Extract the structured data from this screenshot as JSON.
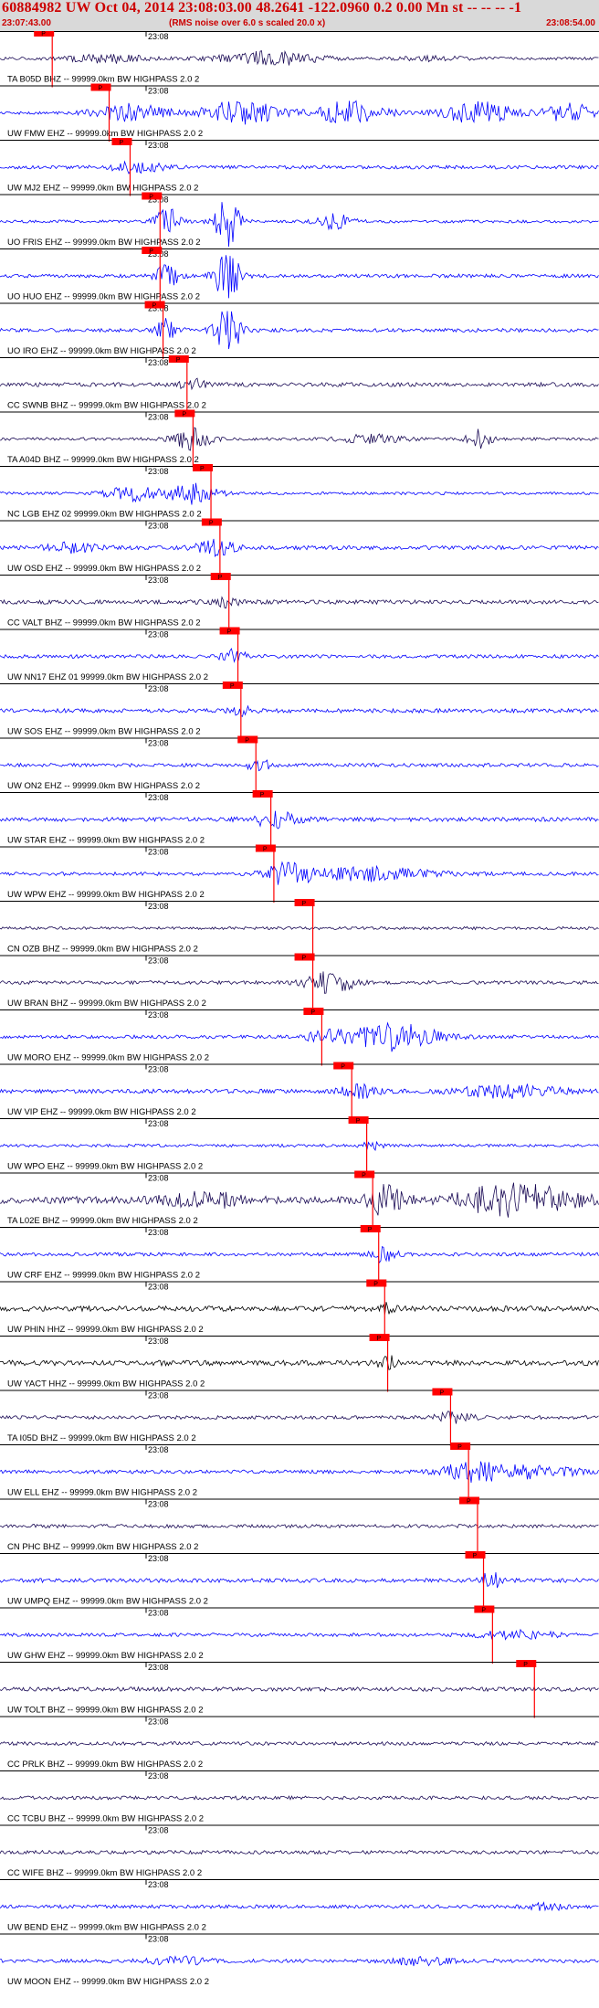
{
  "header": {
    "title": "60884982 UW Oct 04, 2014 23:08:03.00   48.2641 -122.0960  0.2 0.00 Mn st -- -- -- -1",
    "start_time": "23:07:43.00",
    "rms_note": "(RMS noise over 6.0 s scaled 20.0 x)",
    "end_time": "23:08:54.00"
  },
  "colors": {
    "accent": "#cc0000",
    "pick_box": "#ff0000",
    "trace_blue": "#0000ff",
    "trace_navy": "#1a0a55",
    "trace_black": "#000000"
  },
  "tick_label": "23:08",
  "pick_label": "P",
  "traces": [
    {
      "label": "TA B05D BHZ -- 99999.0km BW  HIGHPASS  2.0  2",
      "color": "navy",
      "pick": 0.075,
      "amp": 0.5,
      "seed": 1,
      "bursts": [
        [
          0.18,
          0.06,
          1.4
        ],
        [
          0.45,
          0.08,
          2.2
        ],
        [
          0.72,
          0.05,
          0.7
        ]
      ]
    },
    {
      "label": "UW FMW EHZ -- 99999.0km BW  HIGHPASS  2.0  2",
      "color": "blue",
      "pick": 0.17,
      "amp": 0.5,
      "seed": 2,
      "bursts": [
        [
          0.22,
          0.06,
          3.0
        ],
        [
          0.4,
          0.06,
          4.5
        ],
        [
          0.58,
          0.06,
          3.8
        ],
        [
          0.8,
          0.06,
          3.6
        ],
        [
          0.95,
          0.04,
          3.2
        ]
      ]
    },
    {
      "label": "UW MJ2 EHZ -- 99999.0km BW  HIGHPASS  2.0  2",
      "color": "blue",
      "pick": 0.205,
      "amp": 0.6,
      "seed": 3,
      "bursts": [
        [
          0.23,
          0.04,
          2.0
        ]
      ]
    },
    {
      "label": "UO FRIS EHZ -- 99999.0km BW  HIGHPASS  2.0  2",
      "color": "blue",
      "pick": 0.255,
      "amp": 0.5,
      "seed": 4,
      "bursts": [
        [
          0.28,
          0.02,
          5.0
        ],
        [
          0.38,
          0.02,
          9.0
        ],
        [
          0.56,
          0.03,
          2.5
        ]
      ]
    },
    {
      "label": "UO HUO EHZ -- 99999.0km BW  HIGHPASS  2.0  2",
      "color": "blue",
      "pick": 0.255,
      "amp": 0.6,
      "seed": 5,
      "bursts": [
        [
          0.28,
          0.02,
          4.0
        ],
        [
          0.38,
          0.02,
          9.0
        ]
      ]
    },
    {
      "label": "UO IRO EHZ -- 99999.0km BW  HIGHPASS  2.0  2",
      "color": "blue",
      "pick": 0.26,
      "amp": 0.6,
      "seed": 6,
      "bursts": [
        [
          0.28,
          0.02,
          4.0
        ],
        [
          0.38,
          0.02,
          9.0
        ]
      ]
    },
    {
      "label": "CC SWNB BHZ -- 99999.0km BW  HIGHPASS  2.0  2",
      "color": "navy",
      "pick": 0.3,
      "amp": 0.7,
      "seed": 7,
      "bursts": [
        [
          0.32,
          0.02,
          2.0
        ]
      ]
    },
    {
      "label": "TA A04D BHZ -- 99999.0km BW  HIGHPASS  2.0  2",
      "color": "navy",
      "pick": 0.31,
      "amp": 0.5,
      "seed": 8,
      "bursts": [
        [
          0.32,
          0.03,
          4.0
        ],
        [
          0.62,
          0.05,
          1.5
        ],
        [
          0.8,
          0.02,
          3.0
        ]
      ]
    },
    {
      "label": "NC LGB EHZ 02 99999.0km BW  HIGHPASS  2.0  2",
      "color": "blue",
      "pick": 0.34,
      "amp": 0.5,
      "seed": 9,
      "bursts": [
        [
          0.22,
          0.04,
          2.5
        ],
        [
          0.32,
          0.04,
          3.5
        ]
      ]
    },
    {
      "label": "UW OSD EHZ -- 99999.0km BW  HIGHPASS  2.0  2",
      "color": "blue",
      "pick": 0.355,
      "amp": 0.7,
      "seed": 10,
      "bursts": [
        [
          0.36,
          0.03,
          2.5
        ],
        [
          0.12,
          0.04,
          1.5
        ]
      ]
    },
    {
      "label": "CC VALT BHZ -- 99999.0km BW  HIGHPASS  2.0  2",
      "color": "navy",
      "pick": 0.37,
      "amp": 0.7,
      "seed": 11,
      "bursts": [
        [
          0.38,
          0.03,
          1.8
        ]
      ]
    },
    {
      "label": "UW NN17 EHZ 01 99999.0km BW  HIGHPASS  2.0  2",
      "color": "blue",
      "pick": 0.385,
      "amp": 0.6,
      "seed": 12,
      "bursts": [
        [
          0.39,
          0.02,
          2.5
        ]
      ]
    },
    {
      "label": "UW SOS EHZ -- 99999.0km BW  HIGHPASS  2.0  2",
      "color": "blue",
      "pick": 0.39,
      "amp": 0.7,
      "seed": 13,
      "bursts": [
        [
          0.4,
          0.02,
          1.5
        ]
      ]
    },
    {
      "label": "UW ON2 EHZ -- 99999.0km BW  HIGHPASS  2.0  2",
      "color": "blue",
      "pick": 0.415,
      "amp": 0.6,
      "seed": 14,
      "bursts": [
        [
          0.43,
          0.02,
          2.5
        ]
      ]
    },
    {
      "label": "UW STAR EHZ -- 99999.0km BW  HIGHPASS  2.0  2",
      "color": "blue",
      "pick": 0.44,
      "amp": 0.7,
      "seed": 15,
      "bursts": [
        [
          0.46,
          0.04,
          2.5
        ]
      ]
    },
    {
      "label": "UW WPW EHZ -- 99999.0km BW  HIGHPASS  2.0  2",
      "color": "blue",
      "pick": 0.445,
      "amp": 0.6,
      "seed": 16,
      "bursts": [
        [
          0.48,
          0.04,
          3.5
        ],
        [
          0.62,
          0.1,
          2.2
        ]
      ]
    },
    {
      "label": "CN OZB BHZ -- 99999.0km BW  HIGHPASS  2.0  2",
      "color": "navy",
      "pick": 0.51,
      "amp": 0.5,
      "seed": 17,
      "bursts": []
    },
    {
      "label": "UW BRAN BHZ -- 99999.0km BW  HIGHPASS  2.0  2",
      "color": "navy",
      "pick": 0.51,
      "amp": 0.6,
      "seed": 18,
      "bursts": [
        [
          0.55,
          0.04,
          3.5
        ]
      ]
    },
    {
      "label": "UW MORO EHZ -- 99999.0km BW  HIGHPASS  2.0  2",
      "color": "blue",
      "pick": 0.525,
      "amp": 0.6,
      "seed": 19,
      "bursts": [
        [
          0.55,
          0.04,
          1.8
        ],
        [
          0.66,
          0.07,
          4.5
        ]
      ]
    },
    {
      "label": "UW VIP EHZ -- 99999.0km BW  HIGHPASS  2.0  2",
      "color": "blue",
      "pick": 0.575,
      "amp": 0.7,
      "seed": 20,
      "bursts": [
        [
          0.6,
          0.03,
          2.2
        ],
        [
          0.85,
          0.08,
          2.2
        ]
      ]
    },
    {
      "label": "UW WPO EHZ -- 99999.0km BW  HIGHPASS  2.0  2",
      "color": "blue",
      "pick": 0.6,
      "amp": 0.5,
      "seed": 21,
      "bursts": [
        [
          0.62,
          0.02,
          1.2
        ]
      ]
    },
    {
      "label": "TA L02E BHZ -- 99999.0km BW  HIGHPASS  2.0  2",
      "color": "navy",
      "pick": 0.61,
      "amp": 1.2,
      "seed": 22,
      "bursts": [
        [
          0.34,
          0.06,
          2.5
        ],
        [
          0.64,
          0.03,
          4.5
        ],
        [
          0.86,
          0.1,
          5.0
        ]
      ]
    },
    {
      "label": "UW CRF EHZ -- 99999.0km BW  HIGHPASS  2.0  2",
      "color": "blue",
      "pick": 0.62,
      "amp": 0.6,
      "seed": 23,
      "bursts": [
        [
          0.64,
          0.02,
          2.5
        ]
      ]
    },
    {
      "label": "UW PHIN HHZ -- 99999.0km BW  HIGHPASS  2.0  2",
      "color": "black",
      "pick": 0.63,
      "amp": 0.9,
      "seed": 24,
      "bursts": [
        [
          0.645,
          0.015,
          1.5
        ]
      ]
    },
    {
      "label": "UW YACT HHZ -- 99999.0km BW  HIGHPASS  2.0  2",
      "color": "black",
      "pick": 0.635,
      "amp": 0.9,
      "seed": 25,
      "bursts": [
        [
          0.645,
          0.015,
          2.5
        ]
      ]
    },
    {
      "label": "TA I05D BHZ -- 99999.0km BW  HIGHPASS  2.0  2",
      "color": "navy",
      "pick": 0.74,
      "amp": 0.6,
      "seed": 26,
      "bursts": [
        [
          0.76,
          0.03,
          1.8
        ]
      ]
    },
    {
      "label": "UW ELL EHZ -- 99999.0km BW  HIGHPASS  2.0  2",
      "color": "blue",
      "pick": 0.77,
      "amp": 0.6,
      "seed": 27,
      "bursts": [
        [
          0.79,
          0.05,
          3.5
        ],
        [
          0.9,
          0.06,
          2.2
        ]
      ]
    },
    {
      "label": "CN PHC BHZ -- 99999.0km BW  HIGHPASS  2.0  2",
      "color": "navy",
      "pick": 0.785,
      "amp": 0.6,
      "seed": 28,
      "bursts": []
    },
    {
      "label": "UW UMPQ EHZ -- 99999.0km BW  HIGHPASS  2.0  2",
      "color": "blue",
      "pick": 0.795,
      "amp": 0.7,
      "seed": 29,
      "bursts": [
        [
          0.82,
          0.015,
          3.0
        ]
      ]
    },
    {
      "label": "UW GHW EHZ -- 99999.0km BW  HIGHPASS  2.0  2",
      "color": "blue",
      "pick": 0.81,
      "amp": 0.6,
      "seed": 30,
      "bursts": [
        [
          0.86,
          0.06,
          1.5
        ]
      ]
    },
    {
      "label": "UW TOLT BHZ -- 99999.0km BW  HIGHPASS  2.0  2",
      "color": "navy",
      "pick": 0.88,
      "amp": 0.7,
      "seed": 31,
      "bursts": []
    },
    {
      "label": "CC PRLK BHZ -- 99999.0km BW  HIGHPASS  2.0  2",
      "color": "navy",
      "pick": null,
      "amp": 0.6,
      "seed": 32,
      "bursts": []
    },
    {
      "label": "CC TCBU BHZ -- 99999.0km BW  HIGHPASS  2.0  2",
      "color": "navy",
      "pick": null,
      "amp": 0.6,
      "seed": 33,
      "bursts": []
    },
    {
      "label": "CC WIFE BHZ -- 99999.0km BW  HIGHPASS  2.0  2",
      "color": "navy",
      "pick": null,
      "amp": 0.6,
      "seed": 34,
      "bursts": []
    },
    {
      "label": "UW BEND EHZ -- 99999.0km BW  HIGHPASS  2.0  2",
      "color": "blue",
      "pick": null,
      "amp": 0.6,
      "seed": 35,
      "bursts": [
        [
          0.92,
          0.03,
          1.5
        ]
      ]
    },
    {
      "label": "UW MOON EHZ -- 99999.0km BW  HIGHPASS  2.0  2",
      "color": "blue",
      "pick": null,
      "amp": 0.6,
      "seed": 36,
      "bursts": [
        [
          0.3,
          0.05,
          1.3
        ],
        [
          0.7,
          0.05,
          1.3
        ]
      ]
    }
  ]
}
